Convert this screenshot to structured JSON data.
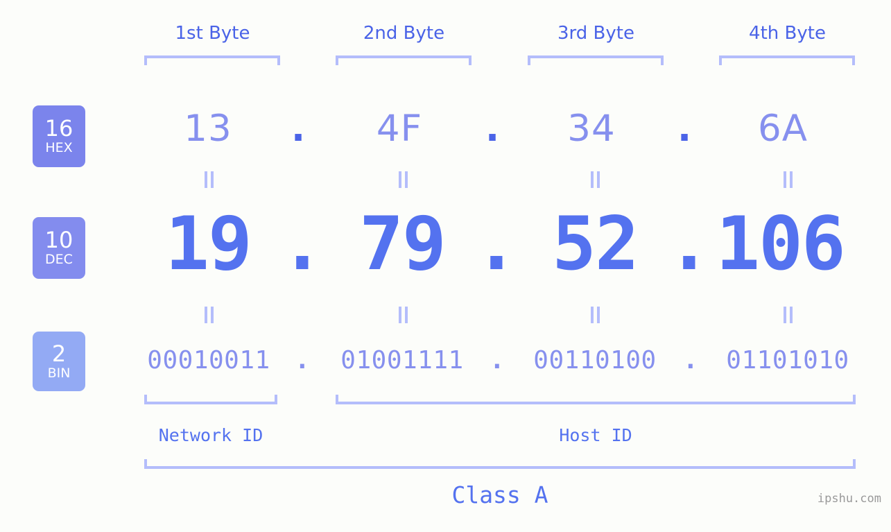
{
  "meta": {
    "background_color": "#fcfdfa",
    "accent_color": "#5472ef",
    "light_accent_color": "#8690ee",
    "bracket_color": "#b4bdfb",
    "watermark": "ipshu.com"
  },
  "byte_headers": [
    {
      "label": "1st Byte"
    },
    {
      "label": "2nd Byte"
    },
    {
      "label": "3rd Byte"
    },
    {
      "label": "4th Byte"
    }
  ],
  "badges": [
    {
      "num": "16",
      "sub": "HEX",
      "color": "#7b84ec"
    },
    {
      "num": "10",
      "sub": "DEC",
      "color": "#838cee"
    },
    {
      "num": "2",
      "sub": "BIN",
      "color": "#93aaf4"
    }
  ],
  "rows": {
    "hex": {
      "values": [
        "13",
        "4F",
        "34",
        "6A"
      ],
      "separator": "."
    },
    "dec": {
      "values": [
        "19",
        "79",
        "52",
        "106"
      ],
      "separator": "."
    },
    "bin": {
      "values": [
        "00010011",
        "01001111",
        "00110100",
        "01101010"
      ],
      "separator": "."
    }
  },
  "equals_symbol": "=",
  "id_sections": [
    {
      "label": "Network ID"
    },
    {
      "label": "Host ID"
    }
  ],
  "class": {
    "label": "Class A"
  }
}
